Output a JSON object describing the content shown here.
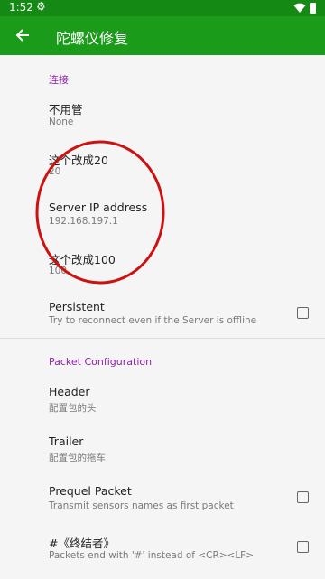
{
  "status_bar": {
    "time": "1:52",
    "gear_glyph": "⚙"
  },
  "app_bar": {
    "title": "陀螺仪修复"
  },
  "sections": {
    "connection": {
      "header": "连接",
      "items": [
        {
          "title": "不用管",
          "summary": "None"
        },
        {
          "title": "这个改成20",
          "summary": "20"
        },
        {
          "title": "Server IP address",
          "summary": "192.168.197.1"
        },
        {
          "title": "这个改成100",
          "summary": "100"
        },
        {
          "title": "Persistent",
          "summary": "Try to reconnect even if the Server is offline",
          "checked": false
        }
      ]
    },
    "packet": {
      "header": "Packet Configuration",
      "items": [
        {
          "title": "Header",
          "summary": "配置包的头"
        },
        {
          "title": "Trailer",
          "summary": "配置包的拖车"
        },
        {
          "title": "Prequel Packet",
          "summary": "Transmit sensors names as first packet",
          "checked": false
        },
        {
          "title": "#《终结者》",
          "summary": "Packets end with '#' instead of <CR><LF>",
          "checked": false
        }
      ]
    }
  },
  "colors": {
    "app_bar": "#1a9b1a",
    "status_bar": "#148a14",
    "category": "#8e24aa",
    "annotation": "#cc1111"
  }
}
